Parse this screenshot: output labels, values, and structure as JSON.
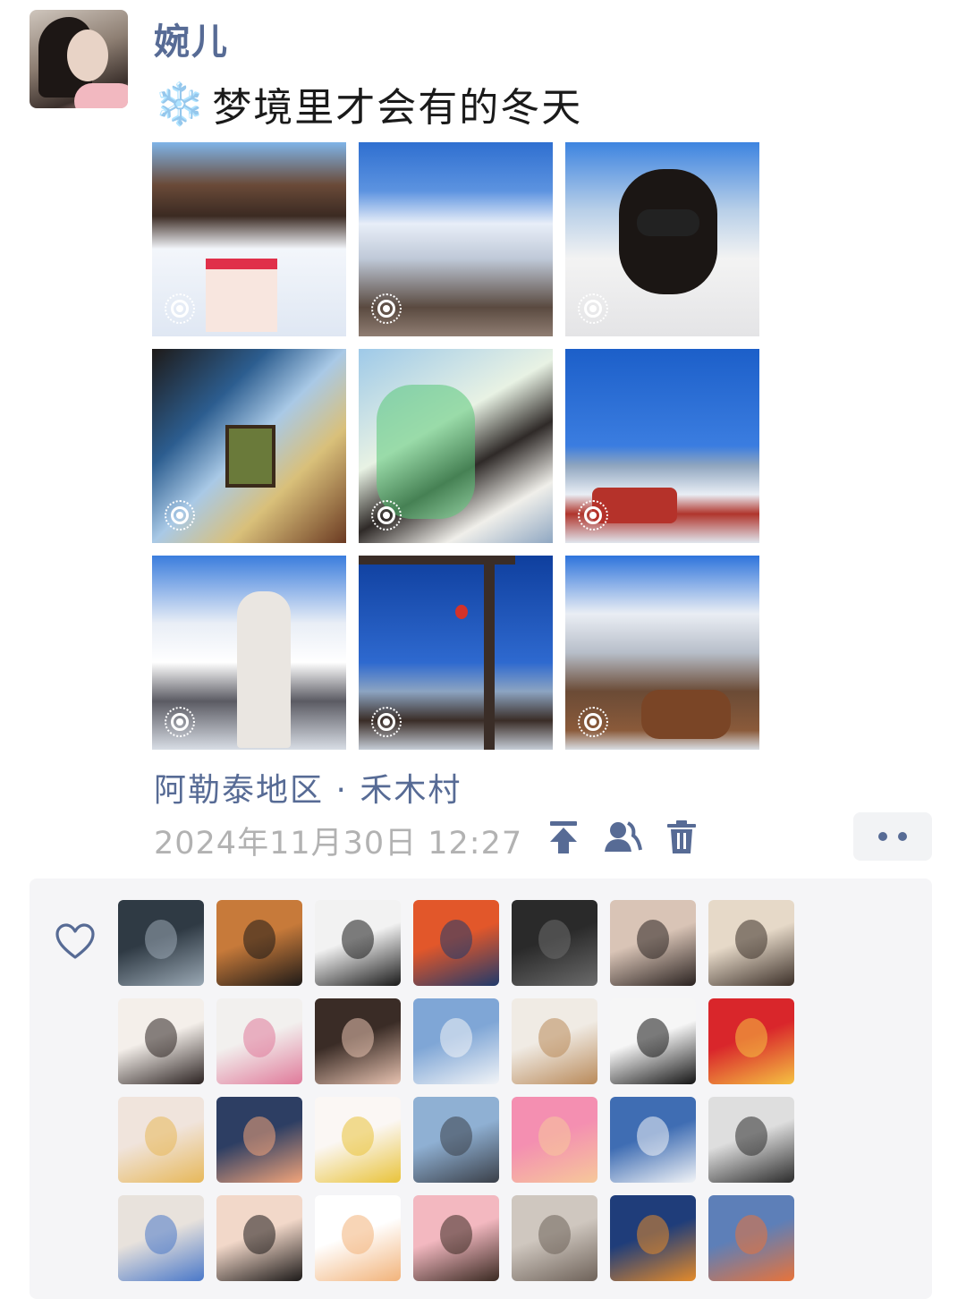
{
  "post": {
    "author": "婉儿",
    "caption_emoji": "❄️",
    "caption": "梦境里才会有的冬天",
    "location": "阿勒泰地区 · 禾木村",
    "timestamp": "2024年11月30日 12:27"
  },
  "photos": [
    {
      "subject": "snowy-cabins-with-cake",
      "live": true
    },
    {
      "subject": "snow-mountain-village",
      "live": true
    },
    {
      "subject": "selfie-in-white-hood",
      "live": true
    },
    {
      "subject": "window-view-with-photo-frame",
      "live": true
    },
    {
      "subject": "girl-with-drawn-flowers",
      "live": true
    },
    {
      "subject": "red-jeep-on-snow-road",
      "live": true
    },
    {
      "subject": "girl-in-snow-village",
      "live": true
    },
    {
      "subject": "wooden-gate-with-lantern",
      "live": true
    },
    {
      "subject": "snowy-cabin-with-horse",
      "live": true
    }
  ],
  "actions": {
    "pin_icon": "pin-to-top-icon",
    "visibility_icon": "visibility-icon",
    "delete_icon": "trash-icon",
    "more_icon": "more-dots-icon"
  },
  "likes": {
    "heart_icon": "heart-outline-icon",
    "avatars": [
      {
        "color_a": "#2f3a44",
        "color_b": "#9aa8b4"
      },
      {
        "color_a": "#c77a3a",
        "color_b": "#1e1a18"
      },
      {
        "color_a": "#f2f2f2",
        "color_b": "#1a1a1a"
      },
      {
        "color_a": "#e2572a",
        "color_b": "#1f3a6b"
      },
      {
        "color_a": "#2a2a2a",
        "color_b": "#6b6b6b"
      },
      {
        "color_a": "#d9c4b6",
        "color_b": "#2a2220"
      },
      {
        "color_a": "#e6d9c8",
        "color_b": "#3b2f28"
      },
      {
        "color_a": "#f4efea",
        "color_b": "#2b2221"
      },
      {
        "color_a": "#f2f0ee",
        "color_b": "#e07a9a"
      },
      {
        "color_a": "#3a2c26",
        "color_b": "#e7c2b0"
      },
      {
        "color_a": "#7fa6d6",
        "color_b": "#f2f4f7"
      },
      {
        "color_a": "#f0ebe4",
        "color_b": "#b98a5a"
      },
      {
        "color_a": "#f6f6f6",
        "color_b": "#141414"
      },
      {
        "color_a": "#d9262b",
        "color_b": "#f5c242"
      },
      {
        "color_a": "#f0e4dc",
        "color_b": "#e7b85a"
      },
      {
        "color_a": "#2d3e63",
        "color_b": "#f2a47a"
      },
      {
        "color_a": "#fbf7f4",
        "color_b": "#e9c33a"
      },
      {
        "color_a": "#8fb0d3",
        "color_b": "#3a3f48"
      },
      {
        "color_a": "#f48fb1",
        "color_b": "#f6c89a"
      },
      {
        "color_a": "#3f6db3",
        "color_b": "#f2f4f7"
      },
      {
        "color_a": "#dedede",
        "color_b": "#2b2b2b"
      },
      {
        "color_a": "#e8e2dc",
        "color_b": "#4a78c9"
      },
      {
        "color_a": "#f2d8c9",
        "color_b": "#1d1a19"
      },
      {
        "color_a": "#ffffff",
        "color_b": "#f2b37a"
      },
      {
        "color_a": "#f3b8c0",
        "color_b": "#3a2a22"
      },
      {
        "color_a": "#cfc7bf",
        "color_b": "#6e6259"
      },
      {
        "color_a": "#1f3d7a",
        "color_b": "#e48a2a"
      },
      {
        "color_a": "#5d7fb8",
        "color_b": "#e8733a"
      }
    ]
  }
}
